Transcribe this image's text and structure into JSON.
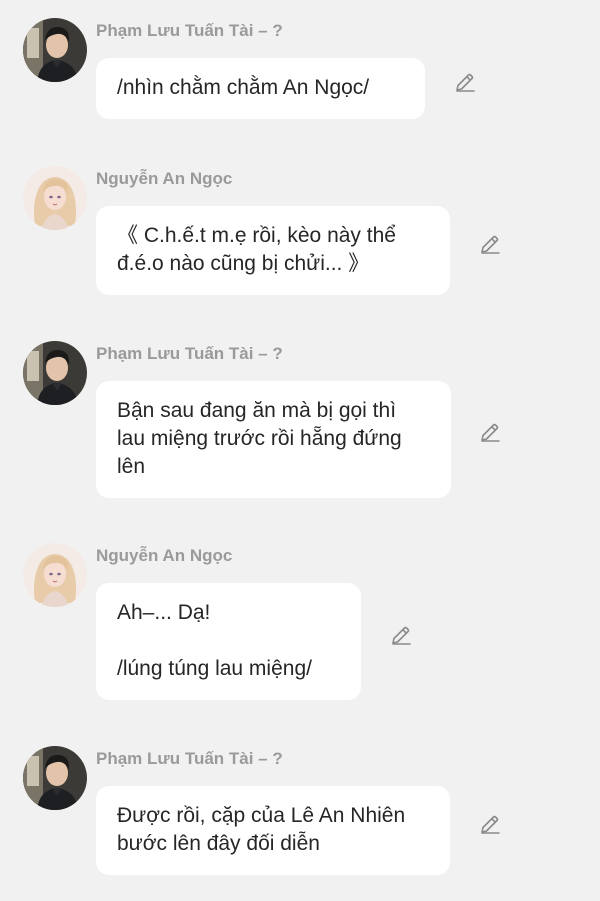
{
  "messages": [
    {
      "sender": "Phạm Lưu Tuấn Tài – ?",
      "avatar": "male-avatar",
      "lines": [
        "/nhìn chằm chằm An Ngọc/"
      ]
    },
    {
      "sender": "Nguyễn An Ngọc",
      "avatar": "female-avatar",
      "lines": [
        "《 C.h.ế.t m.ẹ rồi, kèo này thể",
        "đ.é.o nào cũng bị chửi... 》"
      ]
    },
    {
      "sender": "Phạm Lưu Tuấn Tài – ?",
      "avatar": "male-avatar",
      "lines": [
        "Bận sau đang ăn mà bị gọi thì",
        "lau miệng trước rồi hẵng đứng",
        "lên"
      ]
    },
    {
      "sender": "Nguyễn An Ngọc",
      "avatar": "female-avatar",
      "lines": [
        "Ah–... Dạ!",
        "",
        "/lúng túng lau miệng/"
      ]
    },
    {
      "sender": "Phạm Lưu Tuấn Tài – ?",
      "avatar": "male-avatar",
      "lines": [
        "Được rồi, cặp của Lê An Nhiên",
        "bước lên đây đối diễn"
      ]
    }
  ],
  "icons": {
    "edit": "pencil-icon"
  },
  "colors": {
    "background": "#f1f1f1",
    "bubble": "#ffffff",
    "sender_name": "#9a9a9a",
    "text": "#262626"
  }
}
